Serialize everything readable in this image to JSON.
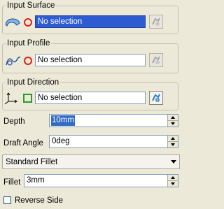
{
  "input_surface": {
    "title": "Input Surface",
    "value": "No selection",
    "icon": "surface-icon",
    "indicator": "circle",
    "active": true
  },
  "input_profile": {
    "title": "Input Profile",
    "value": "No selection",
    "icon": "profile-curve-icon",
    "indicator": "circle"
  },
  "input_direction": {
    "title": "Input Direction",
    "value": "No selection",
    "icon": "axis-icon",
    "indicator": "square"
  },
  "depth": {
    "label": "Depth",
    "value": "10mm"
  },
  "draft_angle": {
    "label": "Draft Angle",
    "value": "0deg"
  },
  "fillet_type": {
    "selected": "Standard Fillet"
  },
  "fillet": {
    "label": "Fillet",
    "value": "3mm"
  },
  "reverse_side": {
    "label": "Reverse Side",
    "checked": false
  },
  "colors": {
    "background": "#ece9d8",
    "selection_active": "#2f5bd0",
    "required_indicator": "#e0201a",
    "optional_indicator": "#2e9a2e"
  }
}
